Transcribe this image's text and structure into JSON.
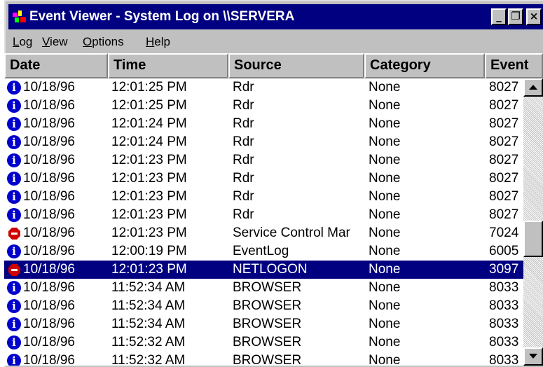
{
  "window": {
    "title": "Event Viewer - System Log on \\\\SERVERA",
    "buttons": {
      "minimize": "_",
      "restore": "❐",
      "close": "×"
    }
  },
  "menu": [
    {
      "mnemonic": "L",
      "rest": "og"
    },
    {
      "mnemonic": "V",
      "rest": "iew"
    },
    {
      "mnemonic": "O",
      "rest": "ptions"
    },
    {
      "mnemonic": "H",
      "rest": "elp"
    }
  ],
  "columns": [
    "Date",
    "Time",
    "Source",
    "Category",
    "Event"
  ],
  "rows": [
    {
      "icon": "info-icon",
      "date": "10/18/96",
      "time": "12:01:25 PM",
      "source": "Rdr",
      "category": "None",
      "event": "8027"
    },
    {
      "icon": "info-icon",
      "date": "10/18/96",
      "time": "12:01:25 PM",
      "source": "Rdr",
      "category": "None",
      "event": "8027"
    },
    {
      "icon": "info-icon",
      "date": "10/18/96",
      "time": "12:01:24 PM",
      "source": "Rdr",
      "category": "None",
      "event": "8027"
    },
    {
      "icon": "info-icon",
      "date": "10/18/96",
      "time": "12:01:24 PM",
      "source": "Rdr",
      "category": "None",
      "event": "8027"
    },
    {
      "icon": "info-icon",
      "date": "10/18/96",
      "time": "12:01:23 PM",
      "source": "Rdr",
      "category": "None",
      "event": "8027"
    },
    {
      "icon": "info-icon",
      "date": "10/18/96",
      "time": "12:01:23 PM",
      "source": "Rdr",
      "category": "None",
      "event": "8027"
    },
    {
      "icon": "info-icon",
      "date": "10/18/96",
      "time": "12:01:23 PM",
      "source": "Rdr",
      "category": "None",
      "event": "8027"
    },
    {
      "icon": "info-icon",
      "date": "10/18/96",
      "time": "12:01:23 PM",
      "source": "Rdr",
      "category": "None",
      "event": "8027"
    },
    {
      "icon": "stop-icon",
      "date": "10/18/96",
      "time": "12:01:23 PM",
      "source": "Service Control Mar",
      "category": "None",
      "event": "7024"
    },
    {
      "icon": "info-icon",
      "date": "10/18/96",
      "time": "12:00:19 PM",
      "source": "EventLog",
      "category": "None",
      "event": "6005"
    },
    {
      "icon": "stop-icon",
      "date": "10/18/96",
      "time": "12:01:23 PM",
      "source": "NETLOGON",
      "category": "None",
      "event": "3097",
      "selected": true
    },
    {
      "icon": "info-icon",
      "date": "10/18/96",
      "time": "11:52:34 AM",
      "source": "BROWSER",
      "category": "None",
      "event": "8033"
    },
    {
      "icon": "info-icon",
      "date": "10/18/96",
      "time": "11:52:34 AM",
      "source": "BROWSER",
      "category": "None",
      "event": "8033"
    },
    {
      "icon": "info-icon",
      "date": "10/18/96",
      "time": "11:52:34 AM",
      "source": "BROWSER",
      "category": "None",
      "event": "8033"
    },
    {
      "icon": "info-icon",
      "date": "10/18/96",
      "time": "11:52:32 AM",
      "source": "BROWSER",
      "category": "None",
      "event": "8033"
    },
    {
      "icon": "info-icon",
      "date": "10/18/96",
      "time": "11:52:32 AM",
      "source": "BROWSER",
      "category": "None",
      "event": "8033"
    }
  ],
  "colors": {
    "title_bar": "#000080",
    "selection": "#000080",
    "info_icon": "#0000cc",
    "stop_icon": "#d00000",
    "face": "#c0c0c0"
  }
}
